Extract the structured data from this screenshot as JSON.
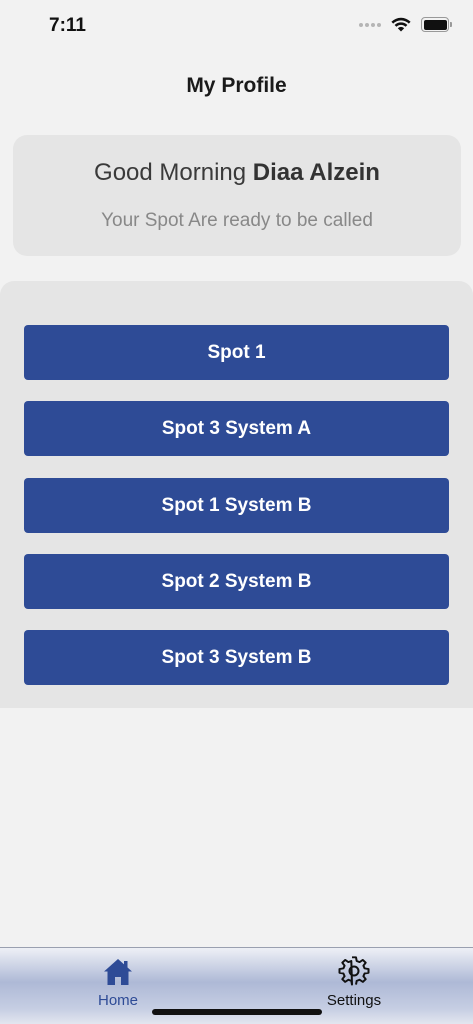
{
  "status_bar": {
    "time": "7:11"
  },
  "header": {
    "title": "My Profile"
  },
  "greeting": {
    "prefix": "Good Morning",
    "name": "Diaa Alzein",
    "subtitle": "Your Spot Are ready to be called"
  },
  "spots": [
    {
      "label": "Spot 1"
    },
    {
      "label": "Spot 3 System A"
    },
    {
      "label": "Spot 1 System B"
    },
    {
      "label": "Spot 2 System B"
    },
    {
      "label": "Spot 3 System B"
    }
  ],
  "tab_bar": {
    "tabs": [
      {
        "label": "Home",
        "icon": "home-icon",
        "active": true
      },
      {
        "label": "Settings",
        "icon": "gear-icon",
        "active": false
      }
    ]
  },
  "colors": {
    "accent": "#2e4b96",
    "background": "#f2f2f2",
    "card": "#e5e5e5"
  }
}
